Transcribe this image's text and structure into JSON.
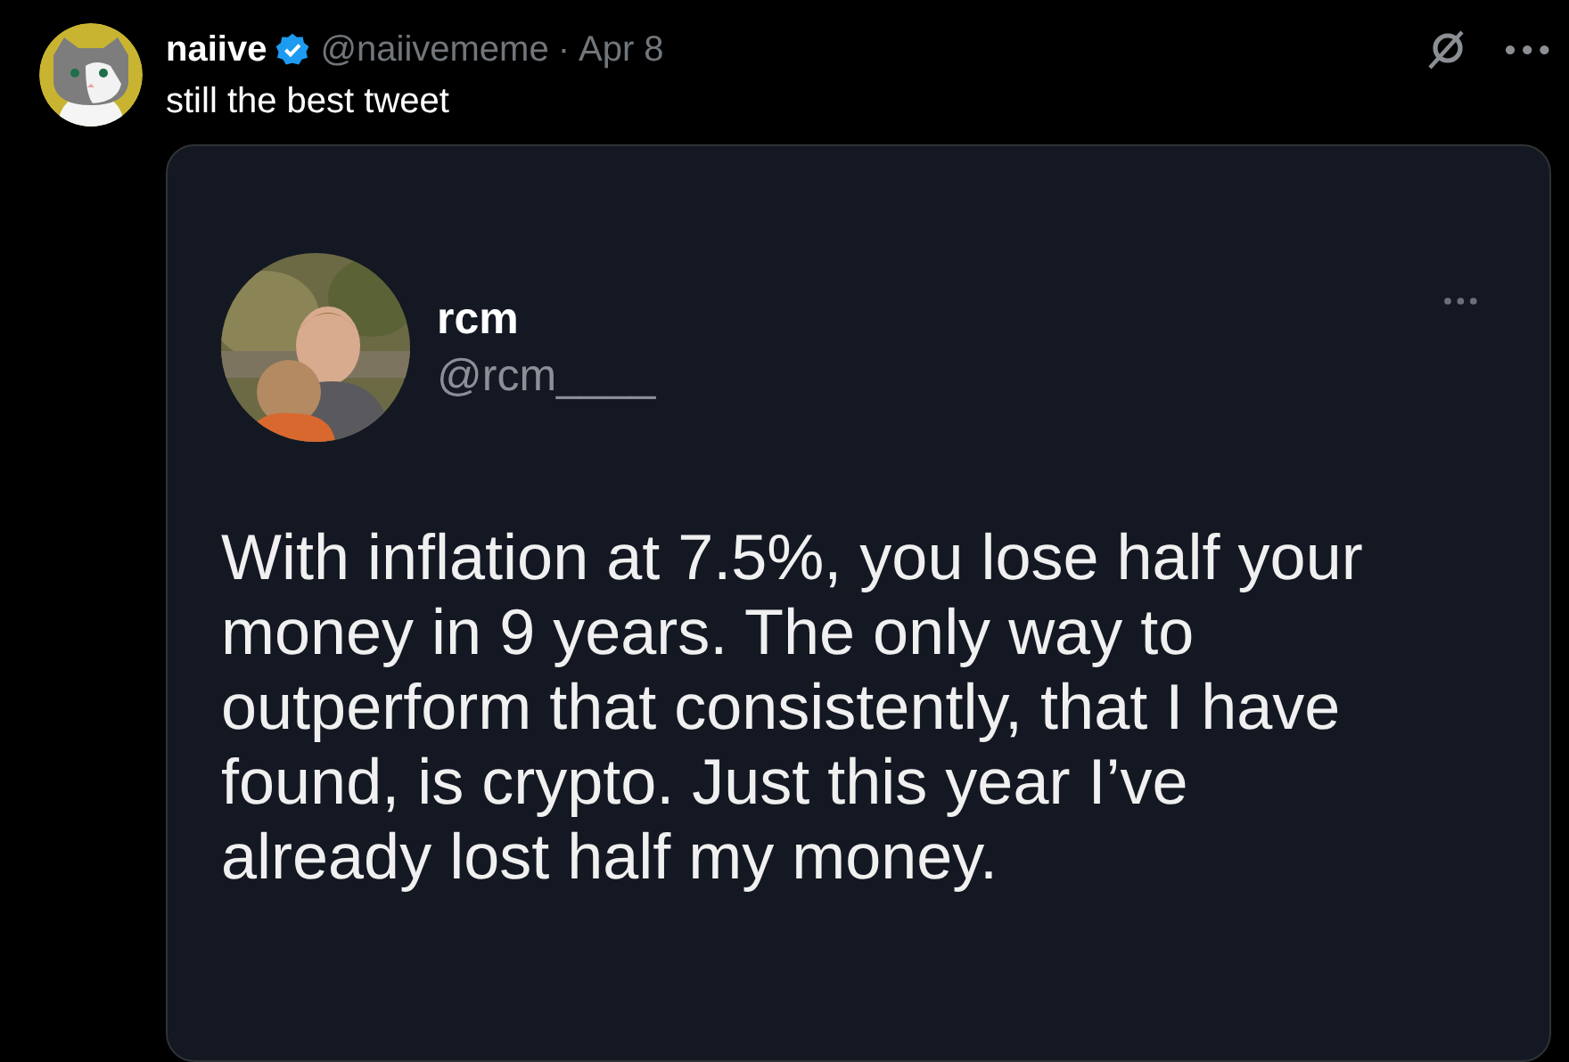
{
  "post": {
    "author": "naiive",
    "verified": true,
    "handle": "@naiivememe",
    "separator": "·",
    "date": "Apr 8",
    "text": "still the best tweet"
  },
  "embedded_screenshot": {
    "author": "rcm",
    "handle": "@rcm____",
    "text": "With inflation at 7.5%, you lose half your money in 9 years. The only way to outperform that consistently, that I have found, is crypto. Just this year I’ve already lost half my money."
  }
}
